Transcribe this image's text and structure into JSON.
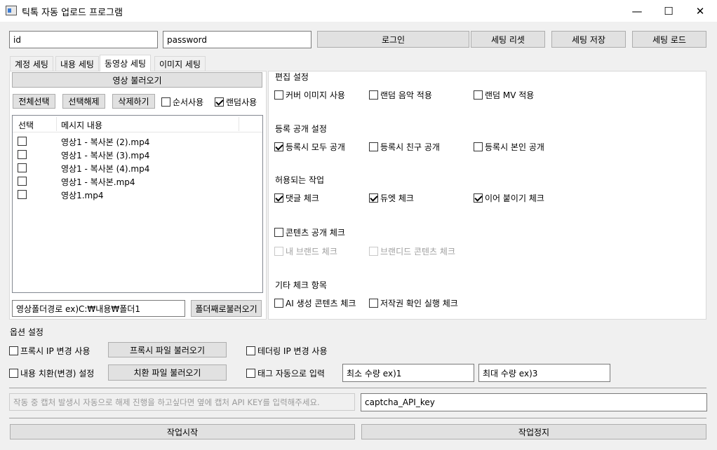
{
  "window": {
    "title": "틱톡 자동 업로드 프로그램"
  },
  "login": {
    "id_value": "id",
    "password_value": "password",
    "login_label": "로그인",
    "reset_label": "세팅 리셋",
    "save_label": "세팅 저장",
    "load_label": "세팅 로드"
  },
  "tabs": [
    "계정 세팅",
    "내용 세팅",
    "동영상 세팅",
    "이미지 세팅"
  ],
  "video": {
    "load_label": "영상 불러오기",
    "select_all": "전체선택",
    "deselect": "선택해제",
    "delete": "삭제하기",
    "order_use": "순서사용",
    "random_use": "랜덤사용",
    "columns": [
      "선택",
      "메시지 내용"
    ],
    "rows": [
      "영상1 - 복사본 (2).mp4",
      "영상1 - 복사본 (3).mp4",
      "영상1 - 복사본 (4).mp4",
      "영상1 - 복사본.mp4",
      "영상1.mp4"
    ],
    "folder_path": "영상폴더경로 ex)C:₩내용₩폴더1",
    "folder_load": "폴더째로불러오기"
  },
  "edit": {
    "title": "편집 설정",
    "cover": "커버 이미지 사용",
    "random_music": "랜덤 음악 적용",
    "random_mv": "랜덤 MV 적용"
  },
  "publish": {
    "title": "등록 공개 설정",
    "all": "등록시 모두 공개",
    "friends": "등록시 친구 공개",
    "self": "등록시 본인 공개"
  },
  "allowed": {
    "title": "허용되는 작업",
    "comment": "댓글 체크",
    "duet": "듀엣 체크",
    "stitch": "이어 붙이기 체크"
  },
  "content": {
    "public": "콘텐츠 공개 체크",
    "my_brand": "내 브랜드 체크",
    "branded": "브랜디드 콘텐츠 체크"
  },
  "other": {
    "title": "기타 체크 항목",
    "ai": "AI 생성 콘텐츠 체크",
    "copyright": "저작권 확인 실행 체크"
  },
  "options": {
    "title": "옵션 설정",
    "proxy_ip": "프록시 IP 변경 사용",
    "proxy_file": "프록시 파일 불러오기",
    "tether_ip": "테더링 IP 변경 사용",
    "replace": "내용 치환(변경) 설정",
    "replace_file": "치환 파일 불러오기",
    "tag_auto": "태그 자동으로 입력",
    "min_qty": "최소 수량 ex)1",
    "max_qty": "최대 수량 ex)3"
  },
  "captcha": {
    "hint": "작동 중 캡처 발생시 자동으로 해제 진행을 하고싶다면 옆에 캡처 API KEY를 입력해주세요.",
    "key": "captcha_API_key"
  },
  "actions": {
    "start": "작업시작",
    "stop": "작업정지"
  }
}
